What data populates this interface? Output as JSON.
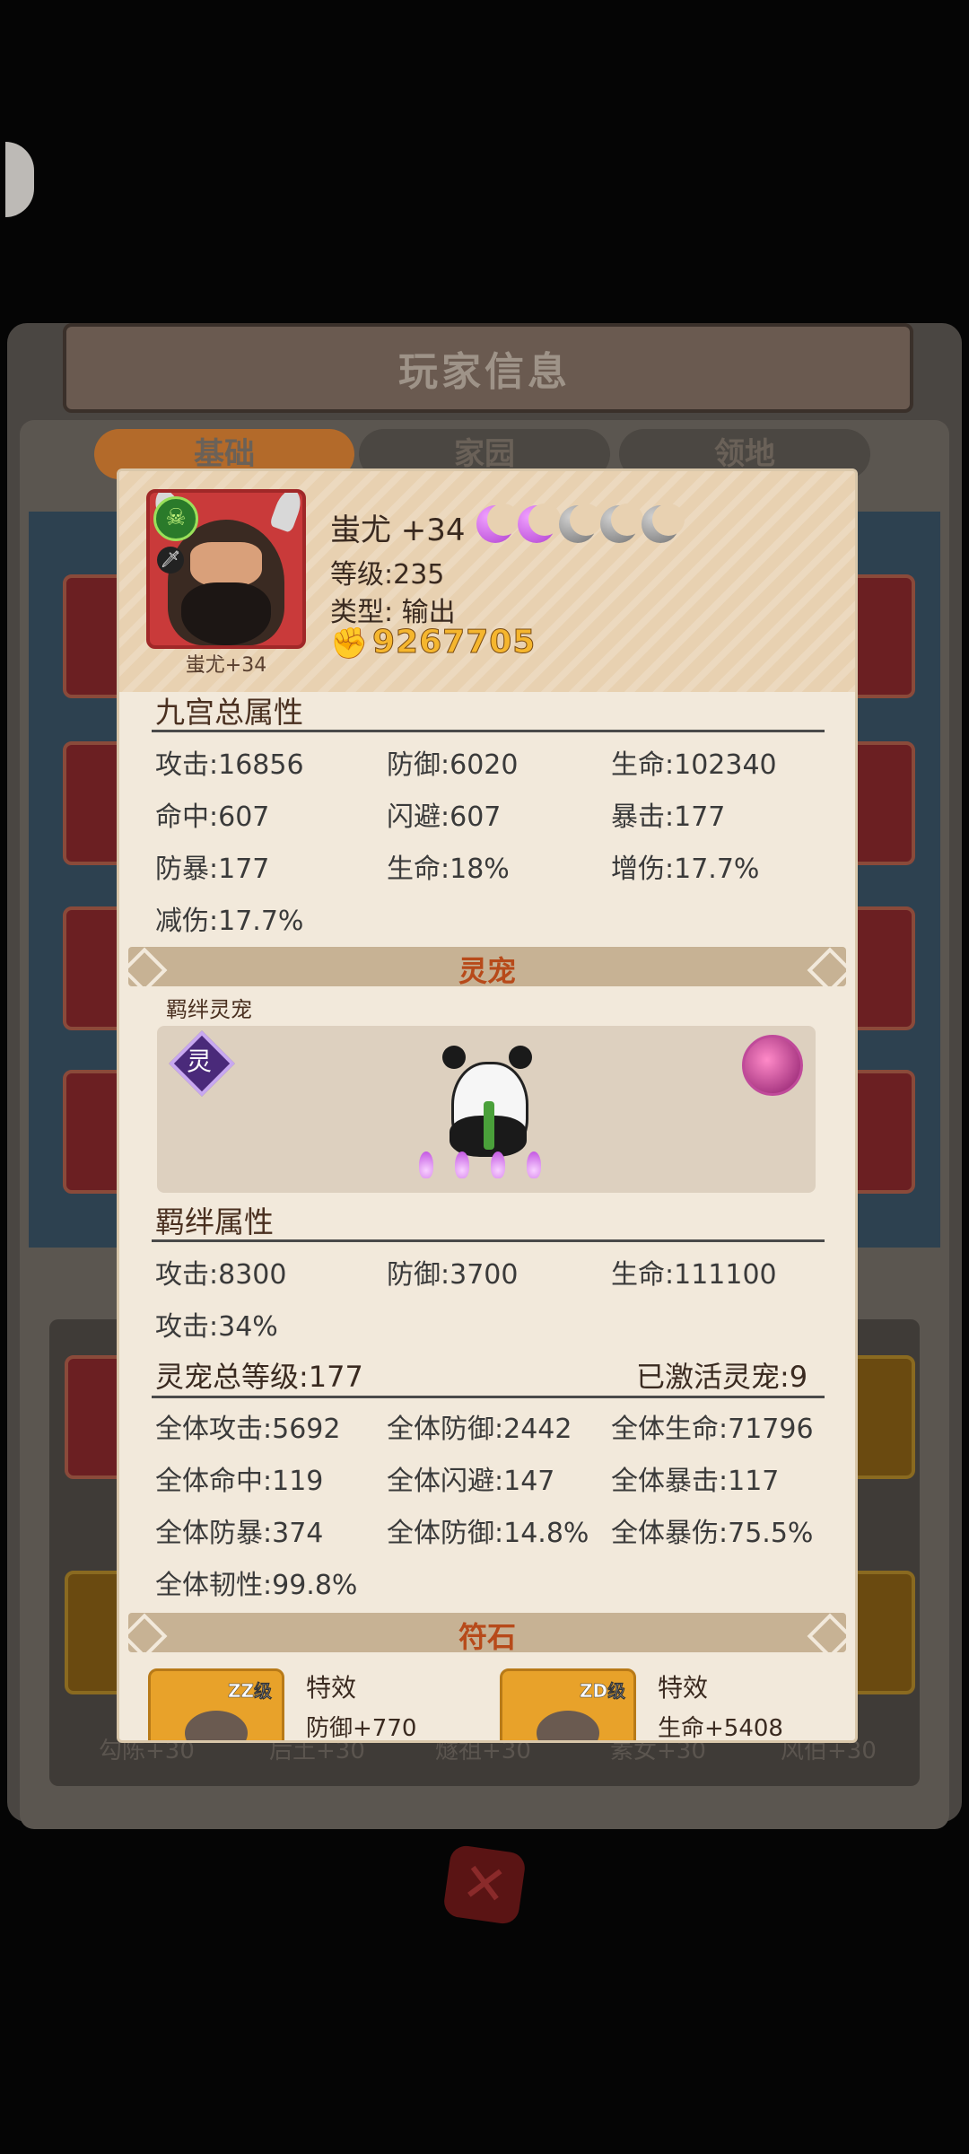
{
  "background": {
    "title": "玩家信息",
    "tabs": [
      "基础",
      "家园",
      "领地"
    ],
    "bottom_names": [
      "勾陈+30",
      "后土+30",
      "燧祖+30",
      "素女+30",
      "风伯+30"
    ]
  },
  "hero": {
    "avatar_label": "蚩尤+34",
    "name": "蚩尤 +34",
    "moons_lit": 2,
    "moons_total": 5,
    "level": "等级:235",
    "type": "类型: 输出",
    "power": "9267705"
  },
  "nine_palace": {
    "title": "九宫总属性",
    "stats": [
      [
        "攻击:16856",
        "防御:6020",
        "生命:102340"
      ],
      [
        "命中:607",
        "闪避:607",
        "暴击:177"
      ],
      [
        "防暴:177",
        "生命:18%",
        "增伤:17.7%"
      ],
      [
        "减伤:17.7%",
        "",
        ""
      ]
    ]
  },
  "spirit_pet": {
    "banner": "灵宠",
    "caption": "羁绊灵宠",
    "badge": "灵",
    "bond_title": "羁绊属性",
    "bond_stats": [
      [
        "攻击:8300",
        "防御:3700",
        "生命:111100"
      ],
      [
        "攻击:34%",
        "",
        ""
      ]
    ],
    "total_level": "灵宠总等级:177",
    "activated": "已激活灵宠:9",
    "global_stats": [
      [
        "全体攻击:5692",
        "全体防御:2442",
        "全体生命:71796"
      ],
      [
        "全体命中:119",
        "全体闪避:147",
        "全体暴击:117"
      ],
      [
        "全体防暴:374",
        "全体防御:14.8%",
        "全体暴伤:75.5%"
      ],
      [
        "全体韧性:99.8%",
        "",
        ""
      ]
    ]
  },
  "rune": {
    "banner": "符石",
    "items": [
      {
        "grade": "ZZ级",
        "label": "特效",
        "effect": "防御+770"
      },
      {
        "grade": "ZD级",
        "label": "特效",
        "effect": "生命+5408"
      }
    ]
  },
  "colors": {
    "popup_bg": "#f2e9db",
    "header_bg": "#e8d1b1",
    "banner_bg": "#c7b294",
    "banner_text": "#b74a1a",
    "power_gold": "#f5b62e"
  }
}
